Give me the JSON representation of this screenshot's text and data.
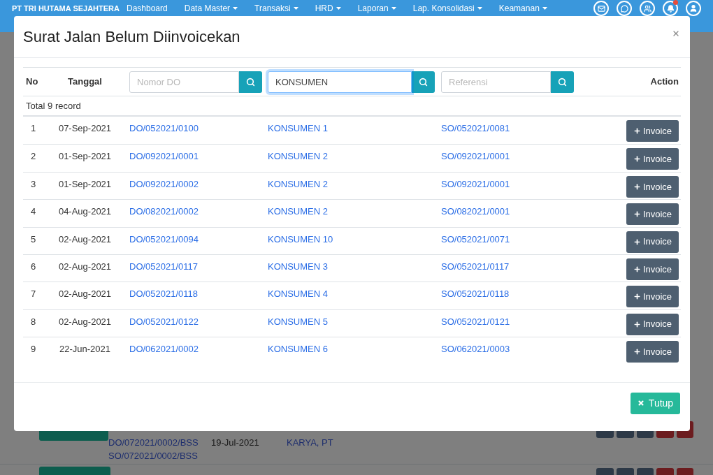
{
  "navbar": {
    "brand": "PT TRI HUTAMA SEJAHTERA",
    "menu": [
      {
        "label": "Dashboard",
        "dropdown": false
      },
      {
        "label": "Data Master",
        "dropdown": true
      },
      {
        "label": "Transaksi",
        "dropdown": true
      },
      {
        "label": "HRD",
        "dropdown": true
      },
      {
        "label": "Laporan",
        "dropdown": true
      },
      {
        "label": "Lap. Konsolidasi",
        "dropdown": true
      },
      {
        "label": "Keamanan",
        "dropdown": true
      }
    ],
    "alerts_unread": true
  },
  "background_table": {
    "rows": [
      {
        "do": "DO/072021/0002/BSS",
        "so": "SO/072021/0002/BSS",
        "date": "19-Jul-2021",
        "customer": "KARYA, PT"
      }
    ]
  },
  "modal": {
    "title": "Surat Jalan Belum Diinvoicekan",
    "columns": [
      {
        "kind": "label",
        "label": "No"
      },
      {
        "kind": "label",
        "label": "Tanggal"
      },
      {
        "kind": "search",
        "placeholder": "Nomor DO",
        "focused": false
      },
      {
        "kind": "search",
        "value": "KONSUMEN",
        "focused": true
      },
      {
        "kind": "search",
        "placeholder": "Referensi",
        "focused": false
      },
      {
        "kind": "label",
        "label": "Action"
      }
    ],
    "total": "Total 9 record",
    "rows": [
      {
        "no": "1",
        "date": "07-Sep-2021",
        "do": "DO/052021/0100",
        "customer": "KONSUMEN 1",
        "reference": "SO/052021/0081",
        "action": "Invoice"
      },
      {
        "no": "2",
        "date": "01-Sep-2021",
        "do": "DO/092021/0001",
        "customer": "KONSUMEN 2",
        "reference": "SO/092021/0001",
        "action": "Invoice"
      },
      {
        "no": "3",
        "date": "01-Sep-2021",
        "do": "DO/092021/0002",
        "customer": "KONSUMEN 2",
        "reference": "SO/092021/0001",
        "action": "Invoice"
      },
      {
        "no": "4",
        "date": "04-Aug-2021",
        "do": "DO/082021/0002",
        "customer": "KONSUMEN 2",
        "reference": "SO/082021/0001",
        "action": "Invoice"
      },
      {
        "no": "5",
        "date": "02-Aug-2021",
        "do": "DO/052021/0094",
        "customer": "KONSUMEN 10",
        "reference": "SO/052021/0071",
        "action": "Invoice"
      },
      {
        "no": "6",
        "date": "02-Aug-2021",
        "do": "DO/052021/0117",
        "customer": "KONSUMEN 3",
        "reference": "SO/052021/0117",
        "action": "Invoice"
      },
      {
        "no": "7",
        "date": "02-Aug-2021",
        "do": "DO/052021/0118",
        "customer": "KONSUMEN 4",
        "reference": "SO/052021/0118",
        "action": "Invoice"
      },
      {
        "no": "8",
        "date": "02-Aug-2021",
        "do": "DO/052021/0122",
        "customer": "KONSUMEN 5",
        "reference": "SO/052021/0121",
        "action": "Invoice"
      },
      {
        "no": "9",
        "date": "22-Jun-2021",
        "do": "DO/062021/0002",
        "customer": "KONSUMEN 6",
        "reference": "SO/062021/0003",
        "action": "Invoice"
      }
    ],
    "close_button": "Tutup"
  }
}
